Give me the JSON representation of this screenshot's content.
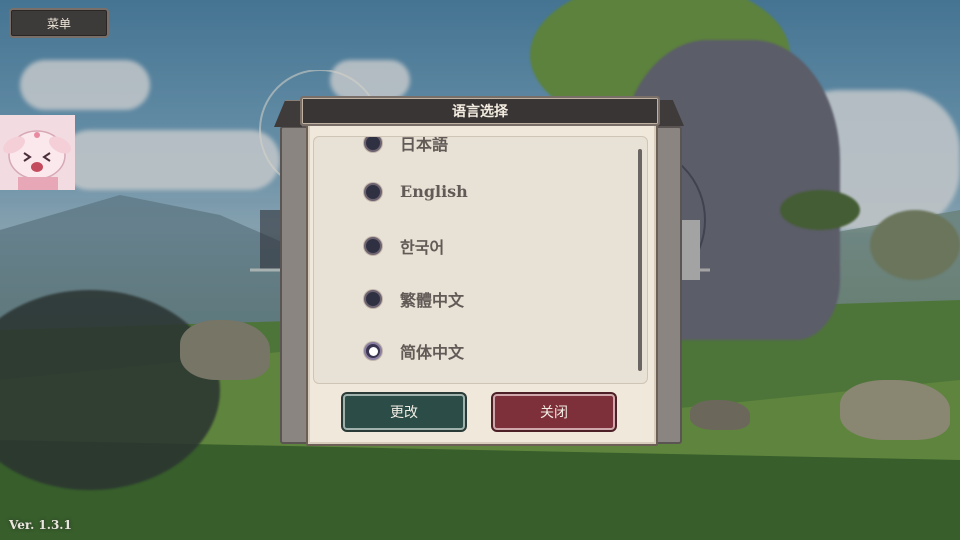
{
  "menu": {
    "label": "菜单"
  },
  "version": {
    "text": "Ver. 1.3.1"
  },
  "dialog": {
    "title": "语言选择",
    "options": [
      {
        "label": "日本語",
        "selected": false
      },
      {
        "label": "English",
        "selected": false
      },
      {
        "label": "한국어",
        "selected": false
      },
      {
        "label": "繁體中文",
        "selected": false
      },
      {
        "label": "简体中文",
        "selected": true
      }
    ],
    "change_button": "更改",
    "close_button": "关闭"
  },
  "colors": {
    "title_bar": "#3a3535",
    "panel": "#f0e8db",
    "change_button": "#2c4c47",
    "close_button": "#7d303a"
  }
}
